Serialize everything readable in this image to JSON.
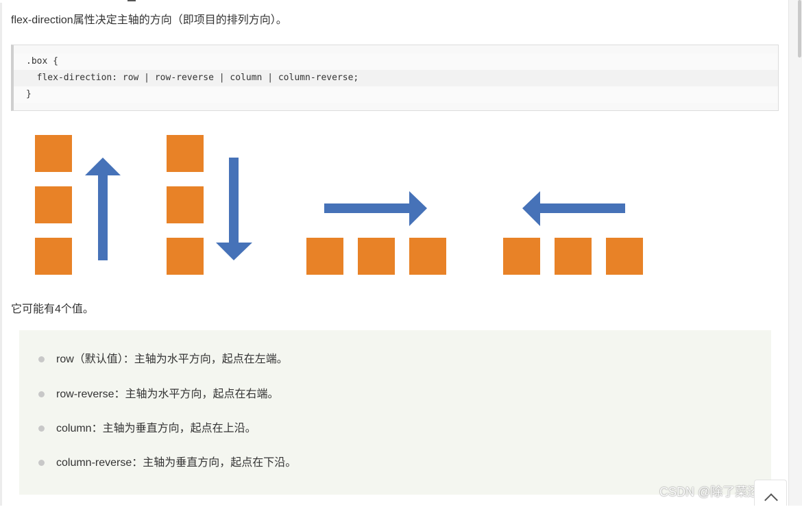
{
  "intro": {
    "text": "flex-direction属性决定主轴的方向（即项目的排列方向）。"
  },
  "code": {
    "lines": [
      ".box {",
      "  flex-direction: row | row-reverse | column | column-reverse;",
      "}"
    ]
  },
  "diagram": {
    "colors": {
      "square": "#e88227",
      "arrow": "#4672b8"
    },
    "arrows": [
      "up",
      "down",
      "right",
      "left"
    ]
  },
  "values": {
    "intro": "它可能有4个值。",
    "items": [
      "row（默认值）：主轴为水平方向，起点在左端。",
      "row-reverse：主轴为水平方向，起点在右端。",
      "column：主轴为垂直方向，起点在上沿。",
      "column-reverse：主轴为垂直方向，起点在下沿。"
    ]
  },
  "watermark": {
    "text": "CSDN @除了菜还是菜"
  },
  "back_to_top": {
    "icon": "chevron-up-icon"
  }
}
